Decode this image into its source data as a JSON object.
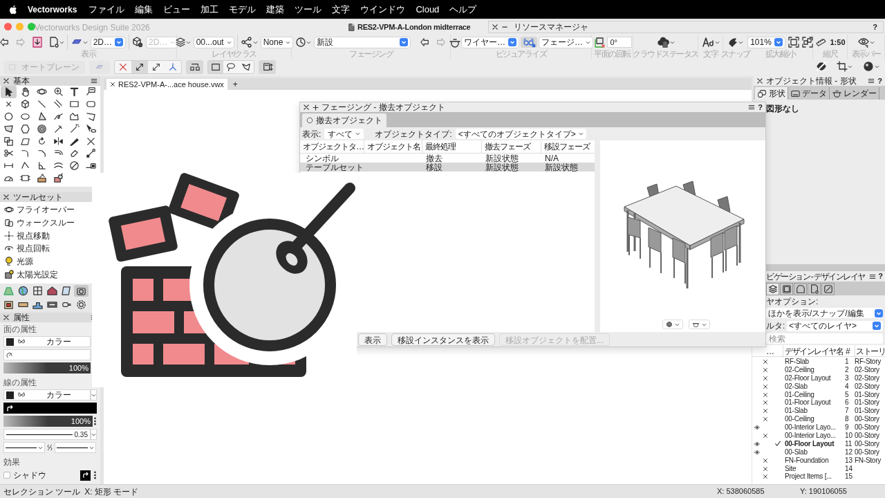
{
  "menu_bar": {
    "app": "Vectorworks",
    "items": [
      "ファイル",
      "編集",
      "ビュー",
      "加工",
      "モデル",
      "建築",
      "ツール",
      "文字",
      "ウインドウ",
      "Cloud",
      "ヘルプ"
    ]
  },
  "window": {
    "title": "Vectorworks Design Suite 2026",
    "document": "RES2-VPM-A-London midterrace"
  },
  "resource_manager": {
    "title": "リソースマネージャ",
    "help": "?"
  },
  "toolbar": {
    "view_mode": "2D…",
    "view_mode_2": "2D…",
    "layer": "00...out",
    "class": "None",
    "phase": "新設",
    "render_mode": "ワイヤー…",
    "visualize": "フェージ…",
    "rotation": "0°",
    "zoom": "101%",
    "scale": "1:50",
    "visualize_on": true,
    "auto_plane": {
      "label": "オートプレーン",
      "disabled": true
    },
    "groups": [
      {
        "label": "表示"
      },
      {
        "label": "レイヤ/クラス"
      },
      {
        "label": "フェージング"
      },
      {
        "label": "ビジュアライズ"
      },
      {
        "label": "平面の回転"
      },
      {
        "label": "クラウドステータス"
      },
      {
        "label": "文字"
      },
      {
        "label": "スナップ"
      },
      {
        "label": "拡大/縮小"
      },
      {
        "label": "縮尺"
      },
      {
        "label": "表示バー"
      }
    ]
  },
  "basic_palette": {
    "title": "基本"
  },
  "toolset_palette": {
    "title": "ツールセット",
    "items": [
      "フライオーバー",
      "ウォークスルー",
      "視点移動",
      "視点回転",
      "光源",
      "太陽光設定"
    ]
  },
  "toolset_tabs": [
    {
      "selected": false
    },
    {
      "selected": false
    },
    {
      "selected": false
    },
    {
      "selected": false
    },
    {
      "selected": false
    },
    {
      "selected": true
    },
    {
      "selected": false
    },
    {
      "selected": false
    },
    {
      "selected": false
    },
    {
      "selected": false
    },
    {
      "selected": false
    },
    {
      "selected": false
    }
  ],
  "attributes": {
    "title": "属性",
    "fill_section": "面の属性",
    "fill": {
      "color_mode": "カラー",
      "opacity": {
        "level": 1,
        "reading": "100%"
      }
    },
    "line_section": "線の属性",
    "line": {
      "color_mode": "カラー",
      "opacity": {
        "level": 1,
        "reading": "100%"
      },
      "thickness": "0.35"
    },
    "effects_section": "効果",
    "shadow": {
      "label": "シャドウ",
      "checked": false
    }
  },
  "document_tabs": [
    {
      "label": "RES2-VPM-A-...ace house.vwx",
      "selected": true
    }
  ],
  "new_tab": "+",
  "phasing_dialog": {
    "title": "フェージング - 撤去オブジェクト",
    "help": "?",
    "tabs": [
      {
        "label": "撤去オブジェクト",
        "selected": true
      }
    ],
    "show_label": "表示:",
    "show_value": "すべて",
    "type_label": "オブジェクトタイプ:",
    "type_value": "<すべてのオブジェクトタイプ>",
    "table": {
      "columns": [
        "オブジェクトタ…",
        "オブジェクト名",
        "最終処理",
        "撤去フェーズ",
        "移設フェーズ"
      ],
      "rows": [
        {
          "type": "シンボル",
          "action": "撤去",
          "demolish_phase": "新設状態",
          "move_phase": "N/A",
          "selected": false
        },
        {
          "type": "テーブルセット",
          "action": "移設",
          "demolish_phase": "新設状態",
          "move_phase": "新設状態",
          "selected": true
        }
      ]
    },
    "buttons": [
      {
        "label": "表示",
        "disabled": false
      },
      {
        "label": "移設インスタンスを表示",
        "disabled": false
      },
      {
        "label": "移設オブジェクトを配置...",
        "disabled": true
      }
    ]
  },
  "object_info": {
    "title": "オブジェクト情報 - 形状",
    "help": "?",
    "tabs": [
      {
        "label": "形状",
        "selected": true
      },
      {
        "label": "データ",
        "selected": false
      },
      {
        "label": "レンダー",
        "selected": false
      }
    ],
    "message": "図形なし"
  },
  "navigation": {
    "title": "ビゲーション - デザインレイヤ",
    "help": "?",
    "tabs": [
      {
        "selected": true
      },
      {
        "selected": false
      },
      {
        "selected": false
      },
      {
        "selected": false
      },
      {
        "selected": false
      }
    ],
    "layer_option_label": "ヤオプション:",
    "layer_option": "ほかを表示/スナップ/編集",
    "filter_label": "ルタ:",
    "filter": "<すべてのレイヤ>",
    "search": {
      "placeholder": "検索"
    },
    "columns": [
      "…",
      "デザインレイヤ名",
      "#",
      "ストーリ"
    ],
    "layers": [
      {
        "name": "RF-Slab",
        "number": "1",
        "story": "RF-Story",
        "visible": false,
        "active": false
      },
      {
        "name": "02-Ceiling",
        "number": "2",
        "story": "02-Story",
        "visible": false,
        "active": false
      },
      {
        "name": "02-Floor Layout",
        "number": "3",
        "story": "02-Story",
        "visible": false,
        "active": false
      },
      {
        "name": "02-Slab",
        "number": "4",
        "story": "02-Story",
        "visible": false,
        "active": false
      },
      {
        "name": "01-Ceiling",
        "number": "5",
        "story": "01-Story",
        "visible": false,
        "active": false
      },
      {
        "name": "01-Floor Layout",
        "number": "6",
        "story": "01-Story",
        "visible": false,
        "active": false
      },
      {
        "name": "01-Slab",
        "number": "7",
        "story": "01-Story",
        "visible": false,
        "active": false
      },
      {
        "name": "00-Ceiling",
        "number": "8",
        "story": "00-Story",
        "visible": false,
        "active": false
      },
      {
        "name": "00-Interior Layo...",
        "number": "9",
        "story": "00-Story",
        "visible": true,
        "active": false
      },
      {
        "name": "00-Interior Layo...",
        "number": "10",
        "story": "00-Story",
        "visible": false,
        "active": false
      },
      {
        "name": "00-Floor Layout",
        "number": "11",
        "story": "00-Story",
        "visible": true,
        "active": true
      },
      {
        "name": "00-Slab",
        "number": "12",
        "story": "00-Story",
        "visible": true,
        "active": false
      },
      {
        "name": "FN-Foundation",
        "number": "13",
        "story": "FN-Story",
        "visible": false,
        "active": false
      },
      {
        "name": "Site",
        "number": "14",
        "visible": false,
        "active": false
      },
      {
        "name": "Project Items [...",
        "number": "15",
        "visible": false,
        "active": false
      }
    ]
  },
  "status_bar": {
    "tool": "セレクション ツール",
    "mode": "X: 矩形 モード",
    "x": "X: 538060585",
    "y": "Y: 190106055"
  }
}
